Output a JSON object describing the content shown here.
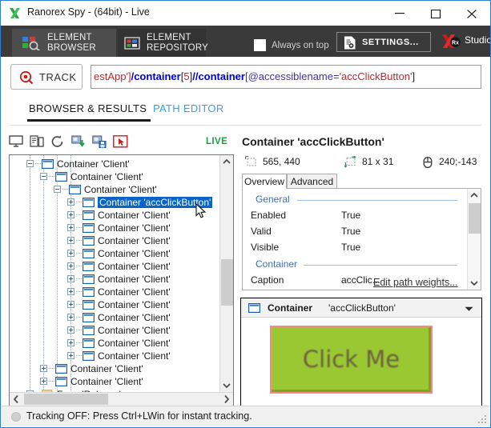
{
  "window": {
    "title": "Ranorex Spy - (64bit) - Live",
    "icon": "ranorex-logo-icon",
    "buttons": {
      "minimize": "minimize-icon",
      "maximize": "maximize-icon",
      "close": "close-icon"
    }
  },
  "ribbon": {
    "tabs": [
      {
        "line1": "ELEMENT",
        "line2": "BROWSER",
        "icon": "element-browser-icon",
        "active": true
      },
      {
        "line1": "ELEMENT",
        "line2": "REPOSITORY",
        "icon": "element-repository-icon",
        "active": false
      }
    ],
    "always_on_top": {
      "label": "Always on top",
      "checked": false
    },
    "settings_label": "SETTINGS...",
    "studio_label": "Studio"
  },
  "track": {
    "button_label": "TRACK",
    "path_segments": [
      {
        "text": "estApp']",
        "color": "#c1272d",
        "style": "red"
      },
      {
        "text": "/",
        "color": "#0000dd",
        "style": "blue"
      },
      {
        "text": "container",
        "color": "#0000dd",
        "style": "blue"
      },
      {
        "text": "[",
        "color": "#222222",
        "style": "dark"
      },
      {
        "text": "5",
        "color": "#c1272d",
        "style": "red"
      },
      {
        "text": "]",
        "color": "#222222",
        "style": "dark"
      },
      {
        "text": "//",
        "color": "#0000dd",
        "style": "blue"
      },
      {
        "text": "container",
        "color": "#0000dd",
        "style": "blue"
      },
      {
        "text": "[@accessiblename=",
        "color": "#4a2fa8",
        "style": "pur"
      },
      {
        "text": "'accClickButton'",
        "color": "#c1272d",
        "style": "red"
      },
      {
        "text": "]",
        "color": "#222222",
        "style": "dark"
      }
    ],
    "path_plain": "estApp']/container[5]//container[@accessiblename='accClickButton']"
  },
  "subtabs": [
    {
      "label": "BROWSER & RESULTS",
      "active": true
    },
    {
      "label": "PATH EDITOR",
      "active": false
    }
  ],
  "tree_panel": {
    "toolbar_icons": [
      "monitor-icon",
      "devices-icon",
      "refresh-icon",
      "load-snapshot-icon",
      "save-snapshot-icon",
      "track-element-icon"
    ],
    "live_label": "LIVE",
    "rows": [
      {
        "label": "Container 'Client'",
        "depth": 2,
        "expander": "minus",
        "selected": false
      },
      {
        "label": "Container 'Client'",
        "depth": 3,
        "expander": "minus",
        "selected": false
      },
      {
        "label": "Container 'Client'",
        "depth": 4,
        "expander": "minus",
        "selected": false
      },
      {
        "label": "Container 'accClickButton'",
        "depth": 5,
        "expander": "plus",
        "selected": true
      },
      {
        "label": "Container 'Client'",
        "depth": 5,
        "expander": "plus",
        "selected": false
      },
      {
        "label": "Container 'Client'",
        "depth": 5,
        "expander": "plus",
        "selected": false
      },
      {
        "label": "Container 'Client'",
        "depth": 5,
        "expander": "plus",
        "selected": false
      },
      {
        "label": "Container 'Client'",
        "depth": 5,
        "expander": "plus",
        "selected": false
      },
      {
        "label": "Container 'Client'",
        "depth": 5,
        "expander": "plus",
        "selected": false
      },
      {
        "label": "Container 'Client'",
        "depth": 5,
        "expander": "plus",
        "selected": false
      },
      {
        "label": "Container 'Client'",
        "depth": 5,
        "expander": "plus",
        "selected": false
      },
      {
        "label": "Container 'Client'",
        "depth": 5,
        "expander": "plus",
        "selected": false
      },
      {
        "label": "Container 'Client'",
        "depth": 5,
        "expander": "plus",
        "selected": false
      },
      {
        "label": "Container 'Client'",
        "depth": 5,
        "expander": "plus",
        "selected": false
      },
      {
        "label": "Container 'Client'",
        "depth": 5,
        "expander": "plus",
        "selected": false
      },
      {
        "label": "Container 'Client'",
        "depth": 5,
        "expander": "plus",
        "selected": false
      },
      {
        "label": "Container 'Client'",
        "depth": 3,
        "expander": "plus",
        "selected": false
      },
      {
        "label": "Container 'Client'",
        "depth": 3,
        "expander": "plus",
        "selected": false
      },
      {
        "label": "Form 'Release'",
        "depth": 2,
        "expander": "plus",
        "selected": false,
        "icon": "form-icon"
      }
    ]
  },
  "detail": {
    "title": "Container 'accClickButton'",
    "metrics": [
      {
        "icon": "position-icon",
        "value": "565, 440"
      },
      {
        "icon": "size-icon",
        "value": "81 x 31"
      },
      {
        "icon": "mouse-icon",
        "value": "240;-143"
      }
    ],
    "tabs": [
      {
        "label": "Overview",
        "active": true
      },
      {
        "label": "Advanced",
        "active": false
      }
    ],
    "groups": [
      {
        "name": "General",
        "rows": [
          {
            "key": "Enabled",
            "value": "True"
          },
          {
            "key": "Valid",
            "value": "True"
          },
          {
            "key": "Visible",
            "value": "True"
          }
        ]
      },
      {
        "name": "Container",
        "rows": [
          {
            "key": "Caption",
            "value": "accClic..."
          }
        ]
      }
    ],
    "edit_path_weights_link": "Edit path weights..."
  },
  "preview": {
    "type_label": "Container",
    "name_label": "'accClickButton'",
    "icon": "container-icon",
    "caret": "chevron-down-icon",
    "button_caption": "Click Me",
    "button_color": "#9ac832",
    "highlight_color": "#f28d7b"
  },
  "status": {
    "text": "Tracking OFF: Press Ctrl+LWin for instant tracking.",
    "indicator": "off"
  }
}
